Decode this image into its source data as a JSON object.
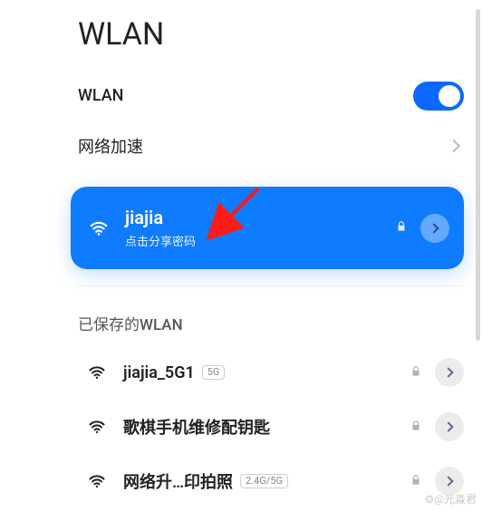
{
  "pageTitle": "WLAN",
  "wlanToggle": {
    "label": "WLAN",
    "on": true
  },
  "accel": {
    "label": "网络加速"
  },
  "connected": {
    "ssid": "jiajia",
    "hint": "点击分享密码",
    "secured": true
  },
  "savedSection": "已保存的WLAN",
  "saved": [
    {
      "ssid": "jiajia_5G1",
      "badge": "5G",
      "secured": true
    },
    {
      "ssid": "歌棋手机维修配钥匙",
      "badge": "",
      "secured": true
    },
    {
      "ssid": "网络升…印拍照",
      "badge": "2.4G/5G",
      "secured": true
    }
  ],
  "annotationColor": "#ff1a1a",
  "watermark": "⚙@光淼君"
}
